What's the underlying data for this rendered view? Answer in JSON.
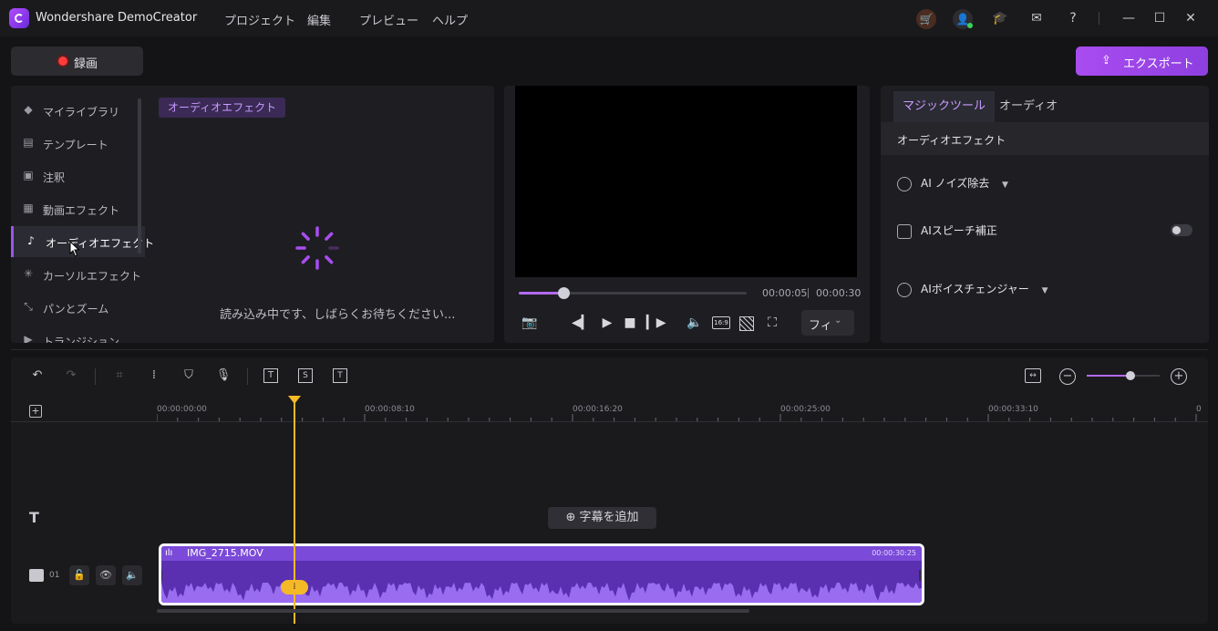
{
  "app": {
    "title": "Wondershare DemoCreator"
  },
  "menu": [
    "プロジェクト",
    "編集",
    "プレビュー",
    "ヘルプ"
  ],
  "header": {
    "record_label": "録画",
    "export_label": "エクスポート"
  },
  "sidebar": {
    "items": [
      {
        "label": "マイライブラリ",
        "icon": "library-icon",
        "glyph": "◆"
      },
      {
        "label": "テンプレート",
        "icon": "template-icon",
        "glyph": "▤"
      },
      {
        "label": "注釈",
        "icon": "annotation-icon",
        "glyph": "▣"
      },
      {
        "label": "動画エフェクト",
        "icon": "video-effect-icon",
        "glyph": "▦"
      },
      {
        "label": "オーディオエフェクト",
        "icon": "audio-effect-icon",
        "glyph": "♪"
      },
      {
        "label": "カーソルエフェクト",
        "icon": "cursor-effect-icon",
        "glyph": "✳"
      },
      {
        "label": "パンとズーム",
        "icon": "pan-zoom-icon",
        "glyph": "⤡"
      },
      {
        "label": "トランジション",
        "icon": "transition-icon",
        "glyph": "▶"
      }
    ],
    "active_index": 4
  },
  "library": {
    "category_chip": "オーディオエフェクト",
    "loading_text": "読み込み中です、しばらくお待ちください..."
  },
  "preview": {
    "current_time": "00:00:05",
    "total_time": "00:00:30",
    "progress_fraction": 0.2,
    "fit_label": "フィ",
    "aspect_label": "16:9"
  },
  "right_panel": {
    "tabs": [
      "マジックツール",
      "オーディオ"
    ],
    "active_tab": 0,
    "section_title": "オーディオエフェクト",
    "tools": [
      {
        "label": "AI ノイズ除去",
        "type": "dropdown",
        "icon": "noise-removal-icon"
      },
      {
        "label": "AIスピーチ補正",
        "type": "toggle",
        "enabled": false,
        "icon": "speech-correction-icon"
      },
      {
        "label": "AIボイスチェンジャー",
        "type": "dropdown",
        "icon": "voice-changer-icon"
      }
    ]
  },
  "timeline": {
    "ruler": [
      "00:00:00:00",
      "00:00:08:10",
      "00:00:16:20",
      "00:00:25:00",
      "00:00:33:10",
      "0"
    ],
    "add_subtitle": "字幕を追加",
    "track_label": "01",
    "clip": {
      "name": "IMG_2715.MOV",
      "duration": "00:00:30:25"
    },
    "zoom_fraction": 0.6
  },
  "colors": {
    "accent": "#9a55f0",
    "playhead": "#f5b928",
    "clip": "#5a30b0",
    "record": "#ff3b3b"
  }
}
